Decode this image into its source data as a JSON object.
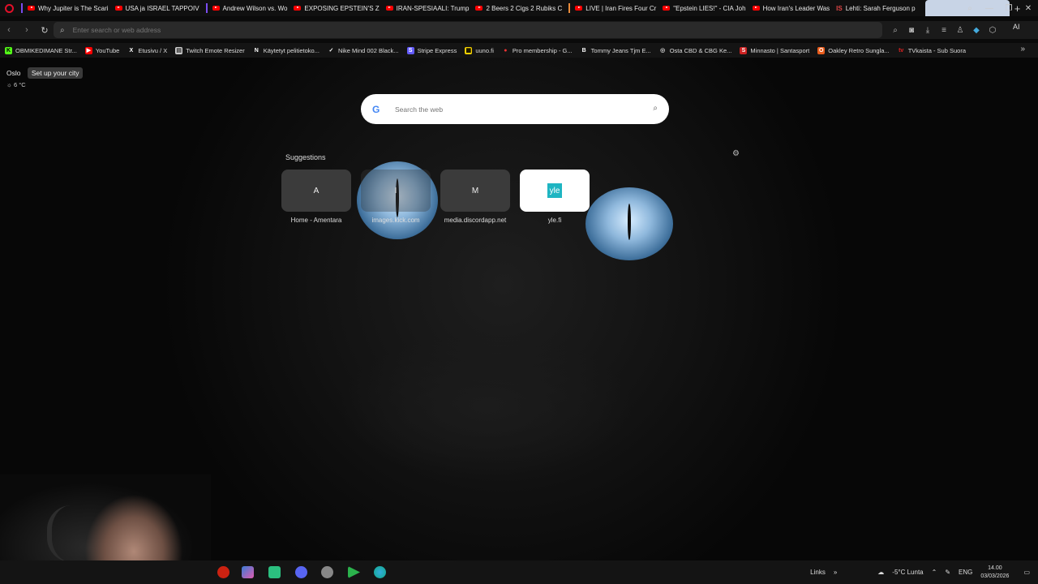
{
  "tabs": [
    {
      "title": "Why Jupiter is The Scari",
      "icon": "youtube-icon"
    },
    {
      "title": "USA ja ISRAEL TAPPOIV",
      "icon": "youtube-icon"
    },
    {
      "title": "Andrew Wilson vs. Wo",
      "icon": "youtube-icon"
    },
    {
      "title": "EXPOSING EPSTEIN'S Z",
      "icon": "youtube-icon"
    },
    {
      "title": "IRAN-SPESIAALI: Trump",
      "icon": "youtube-icon"
    },
    {
      "title": "2 Beers 2 Cigs 2 Rubiks C",
      "icon": "youtube-icon"
    },
    {
      "title": "LIVE | Iran Fires Four Cr",
      "icon": "youtube-icon"
    },
    {
      "title": "\"Epstein LIES!\" - CIA Joh",
      "icon": "youtube-icon"
    },
    {
      "title": "How Iran's Leader Was",
      "icon": "youtube-icon"
    },
    {
      "title": "Lehti: Sarah Ferguson p",
      "icon": "is-icon"
    }
  ],
  "address_bar": {
    "placeholder": "Enter search or web address",
    "value": ""
  },
  "toolbar_ai_label": "AI",
  "bookmarks": [
    {
      "label": "OBMIKEDIMANE Str...",
      "icon": "kick-icon",
      "color": "#53fc18"
    },
    {
      "label": "YouTube",
      "icon": "youtube-icon",
      "color": "#ff0000"
    },
    {
      "label": "Etusivu / X",
      "icon": "x-icon",
      "color": "#ffffff"
    },
    {
      "label": "Twitch Emote Resizer",
      "icon": "page-icon",
      "color": "#dddddd"
    },
    {
      "label": "Käytetyt pelitietoko...",
      "icon": "n-icon",
      "color": "#ffffff"
    },
    {
      "label": "Nike Mind 002 Black...",
      "icon": "nike-icon",
      "color": "#ffffff"
    },
    {
      "label": "Stripe Express",
      "icon": "stripe-icon",
      "color": "#635bff"
    },
    {
      "label": "uuno.fi",
      "icon": "uuno-icon",
      "color": "#f5d000"
    },
    {
      "label": "Pro membership - G...",
      "icon": "pin-icon",
      "color": "#e33"
    },
    {
      "label": "Tommy Jeans Tjm E...",
      "icon": "b-icon",
      "color": "#ffffff"
    },
    {
      "label": "Osta CBD & CBG Ke...",
      "icon": "circle-icon",
      "color": "#cccccc"
    },
    {
      "label": "Minnasto | Santasport",
      "icon": "santasport-icon",
      "color": "#c22"
    },
    {
      "label": "Oakley Retro Sungla...",
      "icon": "oakley-icon",
      "color": "#e85c1c"
    },
    {
      "label": "TVkaista - Sub Suora",
      "icon": "tv-icon",
      "color": "#d22"
    }
  ],
  "weather": {
    "city": "Oslo",
    "setup_label": "Set up your city",
    "temp": "6 °C"
  },
  "search": {
    "placeholder": "Search the web"
  },
  "suggestions": {
    "title": "Suggestions",
    "items": [
      {
        "letter": "A",
        "label": "Home - Amentara"
      },
      {
        "letter": "I",
        "label": "images.kick.com"
      },
      {
        "letter": "M",
        "label": "media.discordapp.net"
      },
      {
        "letter": "yle",
        "label": "yle.fi"
      }
    ]
  },
  "taskbar": {
    "links_label": "Links",
    "weather": "-5°C  Lunta",
    "language": "ENG",
    "time": "14.00",
    "date": "03/03/2026"
  }
}
